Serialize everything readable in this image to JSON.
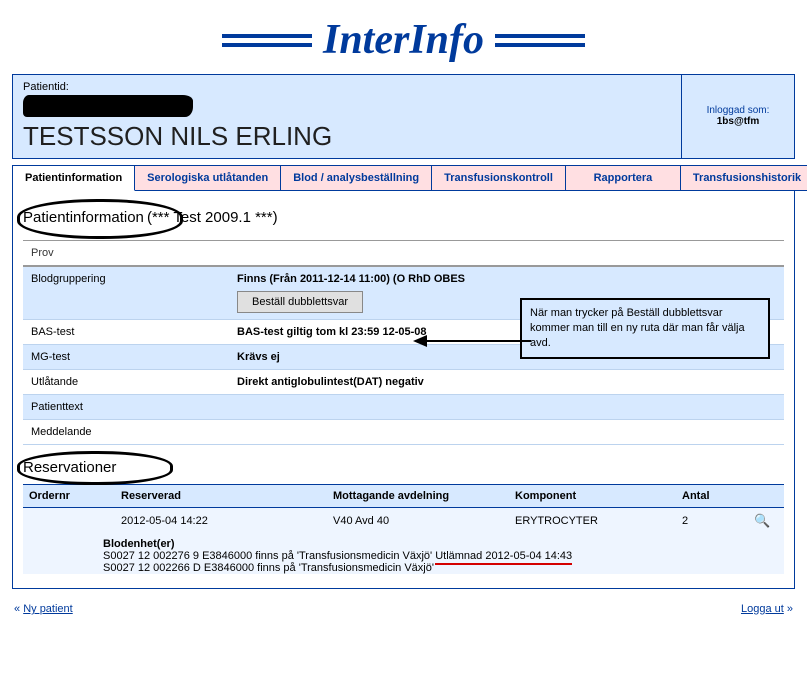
{
  "brand": "InterInfo",
  "header": {
    "patientid_label": "Patientid:",
    "patient_name": "TESTSSON NILS ERLING",
    "login_label": "Inloggad som:",
    "login_user": "1bs@tfm"
  },
  "tabs": [
    {
      "label": "Patientinformation",
      "active": true
    },
    {
      "label": "Serologiska utlåtanden",
      "active": false
    },
    {
      "label": "Blod / analysbeställning",
      "active": false
    },
    {
      "label": "Transfusionskontroll",
      "active": false
    },
    {
      "label": "Rapportera",
      "active": false
    },
    {
      "label": "Transfusionshistorik",
      "active": false
    }
  ],
  "section": {
    "title": "Patientinformation",
    "version": "(*** Test 2009.1 ***)"
  },
  "info": {
    "prov_label": "Prov",
    "blodgruppering_label": "Blodgruppering",
    "blodgruppering_value": "Finns (Från 2011-12-14 11:00) (O RhD OBES",
    "order_button": "Beställ dubblettsvar",
    "bas_label": "BAS-test",
    "bas_value": "BAS-test giltig tom kl 23:59 12-05-08",
    "mg_label": "MG-test",
    "mg_value": "Krävs ej",
    "utlatande_label": "Utlåtande",
    "utlatande_value": "Direkt antiglobulintest(DAT) negativ",
    "patienttext_label": "Patienttext",
    "meddelande_label": "Meddelande"
  },
  "note": "När man trycker på Beställ dubblettsvar kommer man till en ny ruta där man får välja avd.",
  "reservations": {
    "title": "Reservationer",
    "columns": {
      "order": "Ordernr",
      "reserverad": "Reserverad",
      "mottagande": "Mottagande avdelning",
      "komponent": "Komponent",
      "antal": "Antal"
    },
    "row": {
      "reserverad": "2012-05-04 14:22",
      "mottagande": "V40 Avd 40",
      "komponent": "ERYTROCYTER",
      "antal": "2"
    },
    "units_label": "Blodenhet(er)",
    "units": [
      {
        "line_a": "S0027 12 002276 9 E3846000 finns på 'Transfusionsmedicin Växjö' ",
        "line_b": "Utlämnad 2012-05-04 14:43"
      },
      {
        "line_a": "S0027 12 002266 D E3846000 finns på 'Transfusionsmedicin Växjö'",
        "line_b": ""
      }
    ]
  },
  "footer": {
    "ny_patient": "Ny patient",
    "logga_ut": "Logga ut"
  }
}
